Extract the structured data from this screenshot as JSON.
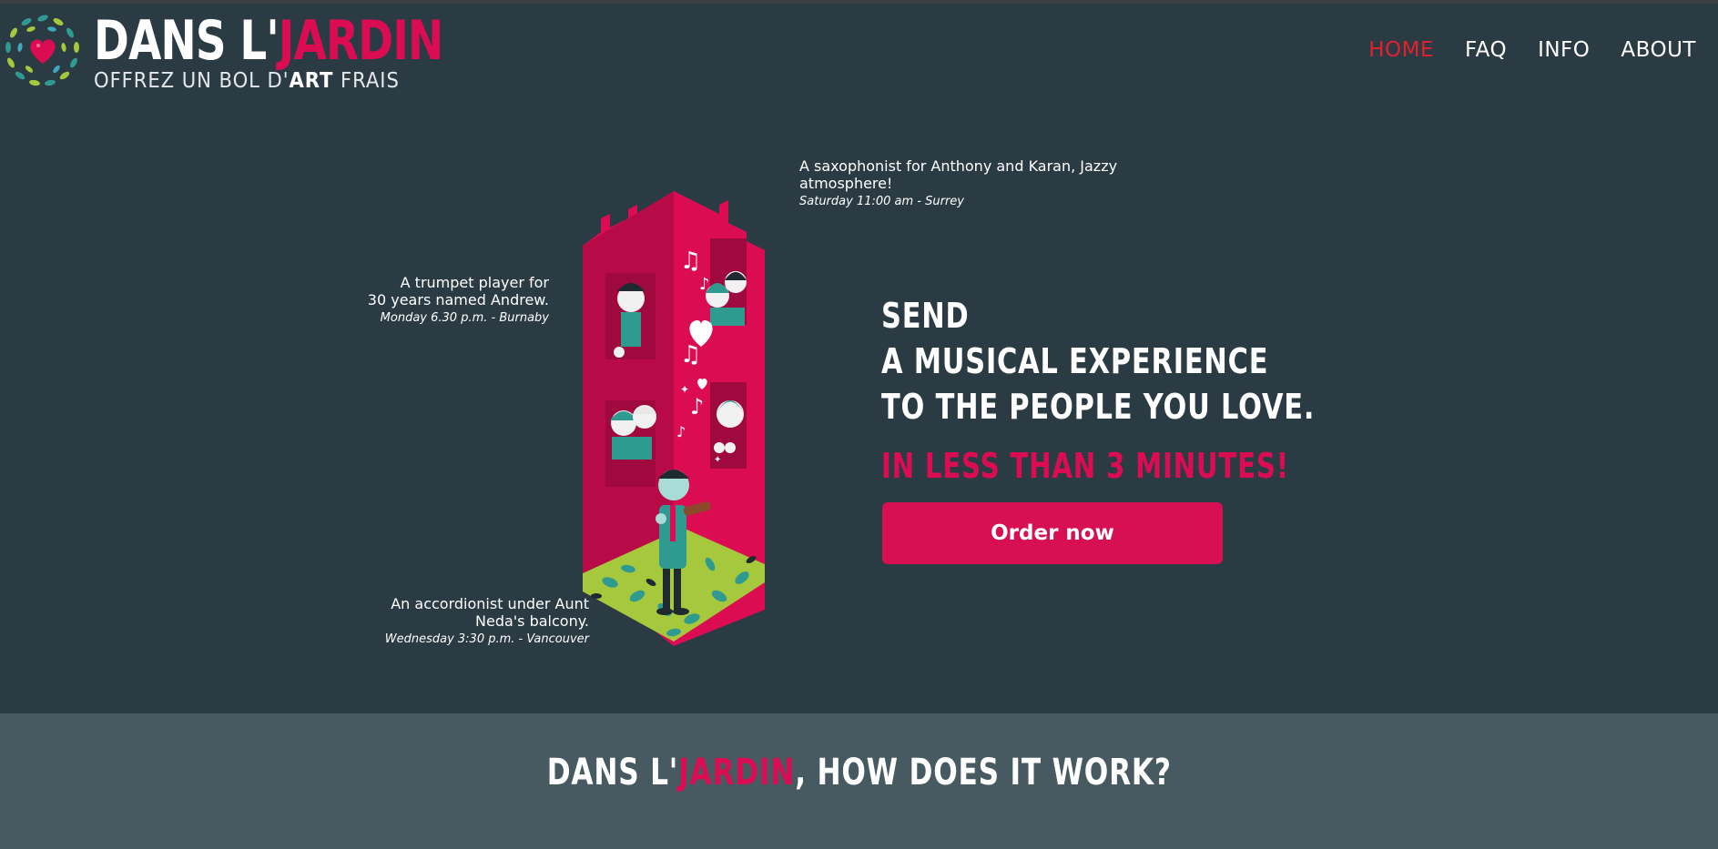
{
  "brand": {
    "title_prefix": "DANS L'",
    "title_highlight": "JARDIN",
    "tagline_start": "OFFREZ UN BOL D'",
    "tagline_bold": "ART",
    "tagline_end": " FRAIS"
  },
  "nav": {
    "items": [
      {
        "label": "HOME",
        "active": true
      },
      {
        "label": "FAQ",
        "active": false
      },
      {
        "label": "INFO",
        "active": false
      },
      {
        "label": "ABOUT",
        "active": false
      }
    ]
  },
  "hero": {
    "notes": {
      "saxophonist": {
        "text": "A saxophonist for Anthony and Karan, Jazzy atmosphere!",
        "meta": "Saturday 11:00 am - Surrey"
      },
      "trumpet": {
        "line1": "A trumpet player for",
        "line2": "30 years named Andrew.",
        "meta": "Monday 6.30 p.m. - Burnaby"
      },
      "accordionist": {
        "line1": "An accordionist under Aunt",
        "line2": "Neda's balcony.",
        "meta": "Wednesday 3:30 p.m. - Vancouver"
      }
    },
    "headline": {
      "line1": "SEND",
      "line2": "A MUSICAL EXPERIENCE",
      "line3": "TO THE PEOPLE YOU LOVE."
    },
    "subheadline": "IN LESS THAN 3 MINUTES!",
    "cta_label": "Order now"
  },
  "how_it_works": {
    "title_prefix": "DANS L'",
    "title_highlight": "JARDIN",
    "title_suffix": ", HOW DOES IT WORK?"
  },
  "colors": {
    "background": "#2b3b44",
    "band": "#475a62",
    "accent_pink": "#dc0c53",
    "nav_active": "#e41f2f",
    "leaf_green": "#a5c83c",
    "teal": "#2f9a8f"
  },
  "icons": [
    "heart-wreath-logo-icon",
    "music-note-icon",
    "heart-icon"
  ]
}
